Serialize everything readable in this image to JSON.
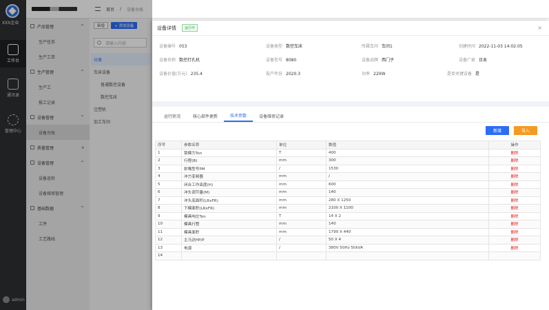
{
  "rail": {
    "brand": "XXX企业",
    "nav": [
      {
        "label": "工作台",
        "icon": "monitor-icon"
      },
      {
        "label": "通讯录",
        "icon": "contacts-icon"
      },
      {
        "label": "管理中心",
        "icon": "gear-icon"
      }
    ],
    "user": "admin"
  },
  "menu": {
    "groups": [
      {
        "label": "产品管理",
        "items": [
          "生产任务",
          "生产工单"
        ]
      },
      {
        "label": "生产管理",
        "items": [
          "生产工",
          "报工记录"
        ]
      },
      {
        "label": "设备管理",
        "items": [
          "设备台账"
        ]
      },
      {
        "label": "质量管理",
        "items": []
      },
      {
        "label": "设备管理",
        "items": [
          "设备巡检",
          "设备维修管理"
        ]
      },
      {
        "label": "基础数据",
        "items": [
          "工序",
          "工艺路线"
        ]
      }
    ]
  },
  "topbar": {
    "crumb1": "首页",
    "sep": "/",
    "crumb2": "设备台账"
  },
  "subbar": {
    "btn1": "新增",
    "btn2": "+ 添加设备",
    "search_placeholder": "请输入内容",
    "tree": [
      "分类",
      "车床设备",
      "普通数控设备",
      "数控车床",
      "注塑机",
      "加工车间"
    ]
  },
  "drawer": {
    "title": "设备详情",
    "status": "运行中",
    "close": "×",
    "fields": [
      {
        "label": "设备编号",
        "value": "053"
      },
      {
        "label": "设备类型",
        "value": "数控车床"
      },
      {
        "label": "所属车间",
        "value": "车间1"
      },
      {
        "label": "创建时间",
        "value": "2022-11-03 14:02:05"
      },
      {
        "label": "设备名称",
        "value": "数控打孔机"
      },
      {
        "label": "设备型号",
        "value": "8080"
      },
      {
        "label": "设备品牌",
        "value": "西门子"
      },
      {
        "label": "设备厂家",
        "value": "日本"
      },
      {
        "label": "设备价值(万元)",
        "value": "235.4"
      },
      {
        "label": "投产年份",
        "value": "2020.3"
      },
      {
        "label": "功率",
        "value": "220W"
      },
      {
        "label": "是否关键设备",
        "value": "是"
      }
    ],
    "tabs": [
      "运行状况",
      "核心部件更新",
      "技术参数",
      "设备维修记录"
    ],
    "active_tab": 2,
    "add_button": "新增",
    "import_button": "导入",
    "table": {
      "headers": [
        "序号",
        "参数名称",
        "单位",
        "数值",
        "操作"
      ],
      "rows": [
        [
          "1",
          "锁模力Ton",
          "T",
          "400",
          "删除"
        ],
        [
          "2",
          "行程(B)",
          "mm",
          "300",
          "删除"
        ],
        [
          "3",
          "射嘴型号PM",
          "/",
          "1530",
          "删除"
        ],
        [
          "4",
          "冲力变频器",
          "mm",
          "/",
          "删除"
        ],
        [
          "5",
          "闭合工作高度(H)",
          "mm",
          "600",
          "删除"
        ],
        [
          "6",
          "冲头调节量(M)",
          "mm",
          "140",
          "删除"
        ],
        [
          "7",
          "冲头底面积(LRxFR)",
          "mm",
          "280 X 1250",
          "删除"
        ],
        [
          "8",
          "下模面积(LRxFR)",
          "mm",
          "2100 X 1100",
          "删除"
        ],
        [
          "9",
          "模具吨位Ton",
          "T",
          "14 X 2",
          "删除"
        ],
        [
          "10",
          "模具行程",
          "mm",
          "140",
          "删除"
        ],
        [
          "11",
          "模具面积",
          "mm",
          "1790 X 440",
          "删除"
        ],
        [
          "12",
          "主马达HP/P",
          "/",
          "50 X 4",
          "删除"
        ],
        [
          "13",
          "电源",
          "/",
          "380V 50Hz 50kVA",
          "删除"
        ],
        [
          "14",
          "",
          "",
          "",
          ""
        ]
      ]
    }
  }
}
